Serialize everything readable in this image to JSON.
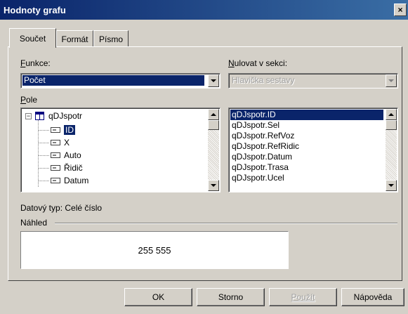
{
  "window": {
    "title": "Hodnoty grafu",
    "close_glyph": "×"
  },
  "tabs": [
    {
      "label": "Součet",
      "active": true
    },
    {
      "label": "Formát",
      "active": false
    },
    {
      "label": "Písmo",
      "active": false
    }
  ],
  "funkce": {
    "label": "Funkce:",
    "value": "Počet"
  },
  "nulovat": {
    "label": "Nulovat v sekci:",
    "value": "Hlavička sestavy",
    "disabled": true
  },
  "pole": {
    "label": "Pole",
    "tree_root": "qDJspotr",
    "tree_fields": [
      "ID",
      "X",
      "Auto",
      "Řidič",
      "Datum"
    ],
    "selected_field": "ID"
  },
  "field_list": {
    "items": [
      "qDJspotr.ID",
      "qDJspotr.Sel",
      "qDJspotr.RefVoz",
      "qDJspotr.RefRidic",
      "qDJspotr.Datum",
      "qDJspotr.Trasa",
      "qDJspotr.Ucel"
    ],
    "selected": "qDJspotr.ID"
  },
  "datovy_typ": {
    "label": "Datový typ:",
    "value": "Celé číslo"
  },
  "nahled": {
    "label": "Náhled",
    "value": "255 555"
  },
  "buttons": {
    "ok": "OK",
    "storno": "Storno",
    "pouzit": "Použít",
    "napoveda": "Nápověda"
  },
  "colors": {
    "titlebar": "#0a246a",
    "selection": "#0a246a",
    "face": "#d4d0c8"
  }
}
